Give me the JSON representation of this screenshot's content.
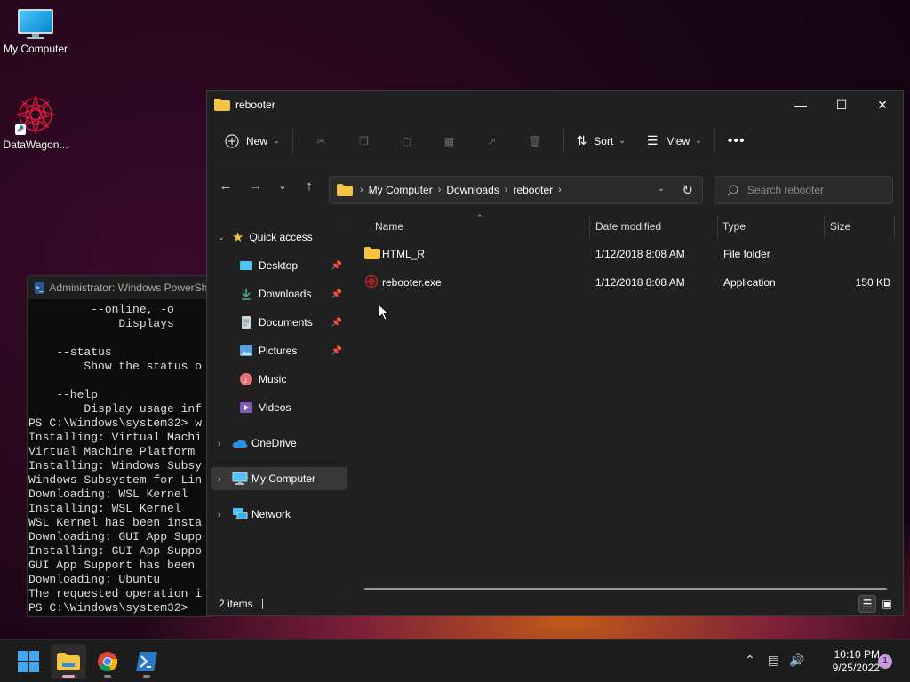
{
  "desktop": {
    "icons": [
      {
        "label": "My Computer"
      },
      {
        "label": "DataWagon..."
      }
    ]
  },
  "powershell": {
    "title": "Administrator: Windows PowerShell",
    "lines": "         --online, -o\n             Displays\n\n    --status\n        Show the status o\n\n    --help\n        Display usage inf\nPS C:\\Windows\\system32> w\nInstalling: Virtual Machi\nVirtual Machine Platform\nInstalling: Windows Subsy\nWindows Subsystem for Lin\nDownloading: WSL Kernel\nInstalling: WSL Kernel\nWSL Kernel has been insta\nDownloading: GUI App Supp\nInstalling: GUI App Suppo\nGUI App Support has been\nDownloading: Ubuntu\nThe requested operation i\nPS C:\\Windows\\system32>"
  },
  "explorer": {
    "title": "rebooter",
    "toolbar": {
      "new_label": "New",
      "sort_label": "Sort",
      "view_label": "View"
    },
    "address": {
      "crumbs": [
        "My Computer",
        "Downloads",
        "rebooter"
      ]
    },
    "search": {
      "placeholder": "Search rebooter"
    },
    "nav": {
      "quick_access": "Quick access",
      "items": [
        "Desktop",
        "Downloads",
        "Documents",
        "Pictures",
        "Music",
        "Videos"
      ],
      "onedrive": "OneDrive",
      "my_computer": "My Computer",
      "network": "Network"
    },
    "columns": {
      "name": "Name",
      "date": "Date modified",
      "type": "Type",
      "size": "Size"
    },
    "files": [
      {
        "name": "HTML_R",
        "date": "1/12/2018 8:08 AM",
        "type": "File folder",
        "size": ""
      },
      {
        "name": "rebooter.exe",
        "date": "1/12/2018 8:08 AM",
        "type": "Application",
        "size": "150 KB"
      }
    ],
    "status": {
      "count": "2 items"
    }
  },
  "taskbar": {
    "time": "10:10 PM",
    "date": "9/25/2022",
    "notifications": "1"
  },
  "colors": {
    "accent": "#0078d4",
    "folder": "#f4c542",
    "window_bg": "#202020"
  }
}
